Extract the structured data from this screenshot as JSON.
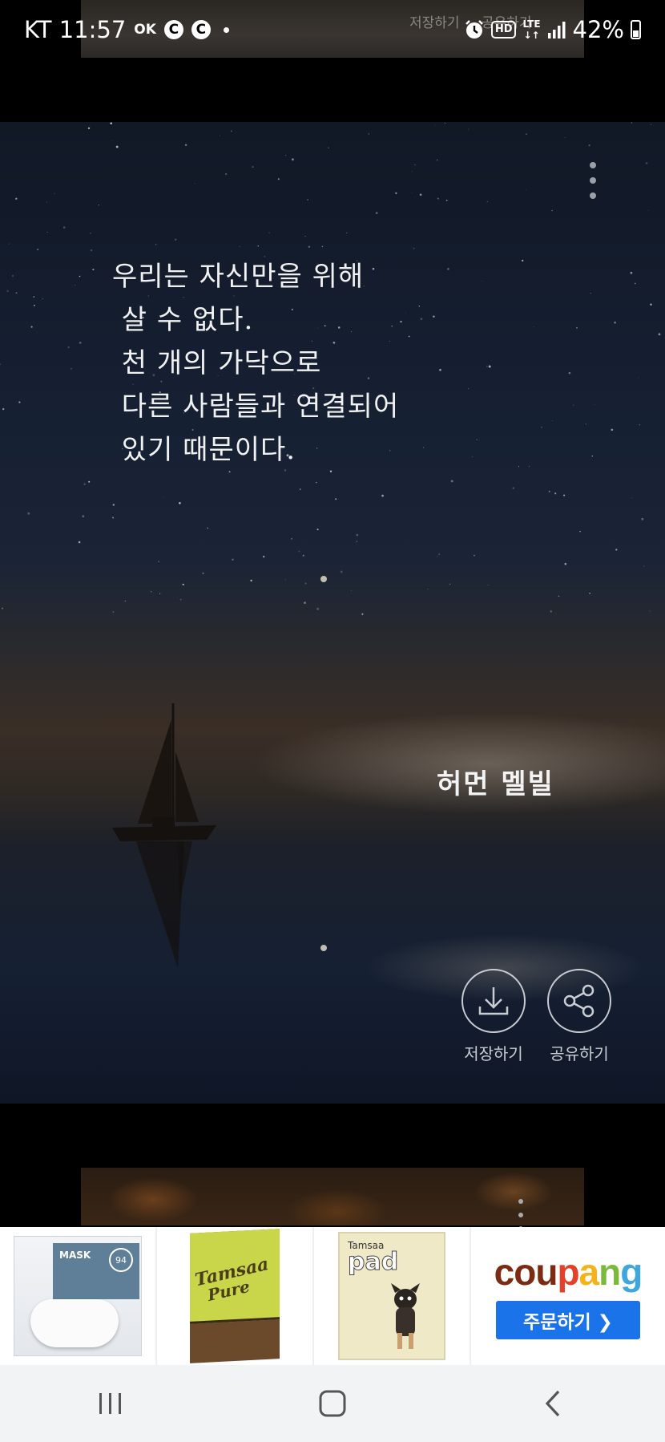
{
  "status_bar": {
    "carrier_time": "KT 11:57",
    "ok_badge": "OK",
    "c_badges": [
      "C",
      "C"
    ],
    "hd": "HD",
    "lte": "LTE",
    "battery": "42%",
    "battery_level": 0.42
  },
  "previous_card": {
    "save_label": "저장하기",
    "share_label": "공유하기"
  },
  "quote_card": {
    "lines": [
      "우리는 자신만을 위해",
      " 살 수 없다.",
      " 천 개의 가닥으로",
      " 다른 사람들과 연결되어",
      " 있기 때문이다."
    ],
    "author": "허먼 멜빌",
    "save_label": "저장하기",
    "share_label": "공유하기"
  },
  "ad_banner": {
    "products": [
      {
        "name": "mask",
        "text": "MASK",
        "badge": "94"
      },
      {
        "name": "tissue",
        "text_1": "Tamsaa",
        "text_2": "Pure"
      },
      {
        "name": "pad",
        "brand": "Tamsaa",
        "text": "pad"
      }
    ],
    "logo_letters": [
      "c",
      "o",
      "u",
      "p",
      "a",
      "n",
      "g"
    ],
    "order_button": "주문하기 ❯",
    "colors": {
      "button": "#1a73e8"
    }
  },
  "nav_bar": {
    "recent_apps": "recent-apps",
    "home": "home",
    "back": "back"
  }
}
